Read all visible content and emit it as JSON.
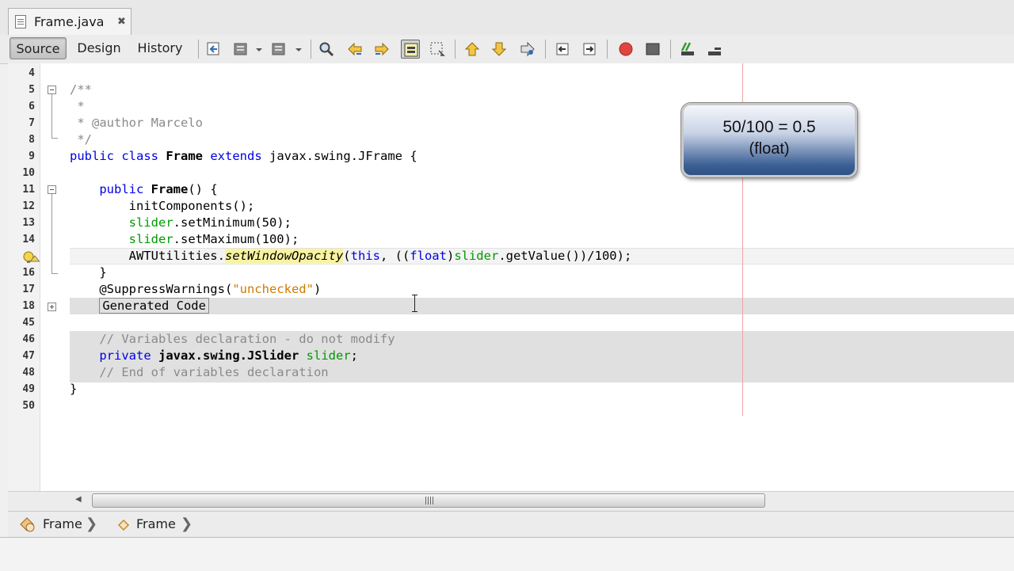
{
  "file_tab": {
    "name": "Frame.java",
    "close_symbol": "✖"
  },
  "view_tabs": {
    "source": "Source",
    "design": "Design",
    "history": "History"
  },
  "toolbar_icons": [
    "last-edit-icon",
    "back-icon",
    "dropdown-icon",
    "forward-icon",
    "dropdown-icon",
    "find-selection-icon",
    "find-previous-icon",
    "find-next-icon",
    "toggle-highlight-icon",
    "toggle-rect-select-icon",
    "shift-left-icon",
    "shift-right-icon",
    "bookmark-icon",
    "prev-bookmark-icon",
    "next-bookmark-icon",
    "record-macro-icon",
    "stop-macro-icon",
    "comment-icon",
    "uncomment-icon"
  ],
  "line_numbers": [
    "4",
    "5",
    "6",
    "7",
    "8",
    "9",
    "10",
    "11",
    "12",
    "13",
    "14",
    "15",
    "16",
    "17",
    "18",
    "45",
    "46",
    "47",
    "48",
    "49",
    "50"
  ],
  "code": {
    "l5": "/**",
    "l6": " *",
    "l7": " * @author Marcelo",
    "l8": " */",
    "l9_kw1": "public class",
    "l9_name": "Frame",
    "l9_kw2": "extends",
    "l9_rest": "javax.swing.JFrame {",
    "l11_kw": "public",
    "l11_name": "Frame",
    "l11_rest": "() {",
    "l12": "initComponents();",
    "l13_field": "slider",
    "l13_rest": ".setMinimum(50);",
    "l14_field": "slider",
    "l14_rest": ".setMaximum(100);",
    "l15_a": "AWTUtilities.",
    "l15_method": "setWindowOpacity",
    "l15_b": "(",
    "l15_this": "this",
    "l15_c": ", ((",
    "l15_float": "float",
    "l15_d": ")",
    "l15_field": "slider",
    "l15_e": ".getValue())/100);",
    "l16": "}",
    "l17_a": "@SuppressWarnings(",
    "l17_str": "\"unchecked\"",
    "l17_b": ")",
    "l18": "Generated Code",
    "l46": "// Variables declaration - do not modify",
    "l47_kw": "private",
    "l47_type": "javax.swing.JSlider",
    "l47_field": "slider",
    "l47_end": ";",
    "l48": "// End of variables declaration",
    "l49": "}"
  },
  "callout": {
    "line1": "50/100 = 0.5",
    "line2": "(float)"
  },
  "navigator": {
    "item1": "Frame",
    "item2": "Frame"
  },
  "colors": {
    "keyword": "#0000e6",
    "comment": "#8a8a8a",
    "string": "#ce7b00",
    "field": "#009900",
    "highlight": "#f8f3a0",
    "guarded_block": "#e0e0e0"
  }
}
